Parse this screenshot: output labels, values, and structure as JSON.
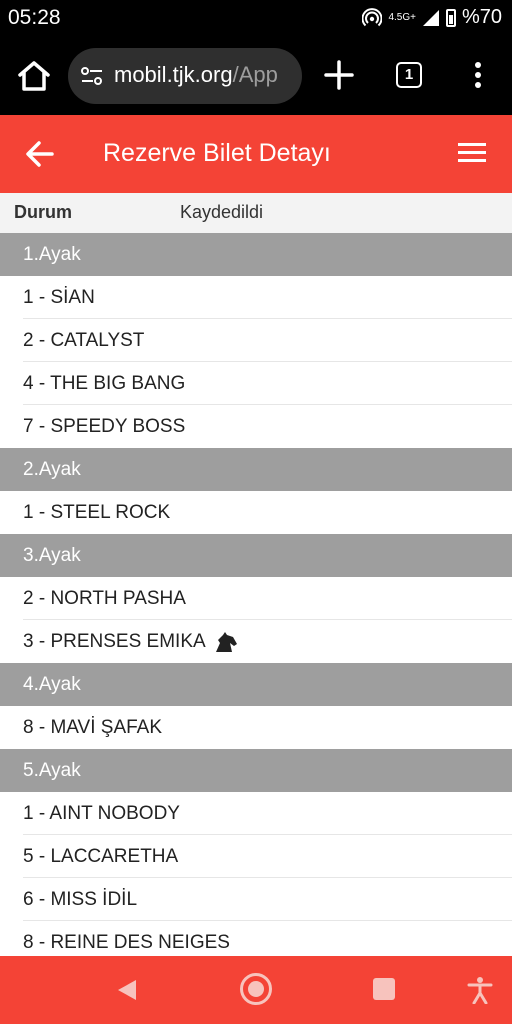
{
  "status": {
    "time": "05:28",
    "network": "4.5G+",
    "battery": "%70"
  },
  "browser": {
    "url_host": "mobil.tjk.org",
    "url_path": "/App",
    "tab_count": "1"
  },
  "appbar": {
    "title": "Rezerve Bilet Detayı"
  },
  "status_row": {
    "label": "Durum",
    "value": "Kaydedildi"
  },
  "legs": [
    {
      "title": "1.Ayak",
      "horses": [
        "1 - SİAN",
        "2 - CATALYST",
        "4 - THE BIG BANG",
        "7 - SPEEDY BOSS"
      ]
    },
    {
      "title": "2.Ayak",
      "horses": [
        "1 - STEEL ROCK"
      ]
    },
    {
      "title": "3.Ayak",
      "horses": [
        "2 - NORTH PASHA",
        "3 - PRENSES EMIKA"
      ]
    },
    {
      "title": "4.Ayak",
      "horses": [
        "8 - MAVİ ŞAFAK"
      ]
    },
    {
      "title": "5.Ayak",
      "horses": [
        "1 - AINT NOBODY",
        "5 - LACCARETHA",
        "6 - MISS İDİL",
        "8 - REINE DES NEIGES"
      ]
    }
  ],
  "icons": {
    "knight": "chess-knight-icon"
  },
  "colors": {
    "accent": "#f44336",
    "leg_header": "#9e9e9e"
  }
}
